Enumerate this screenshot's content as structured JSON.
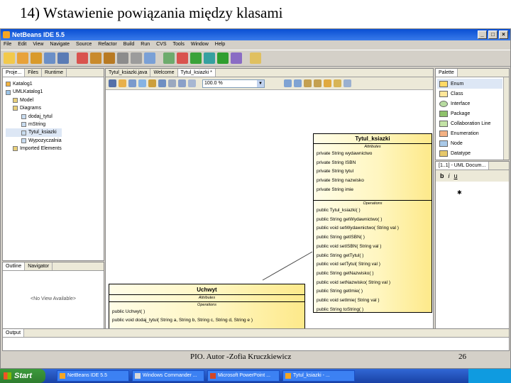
{
  "slide": {
    "title": "14) Wstawienie  powiązania między klasami",
    "footer": "PIO.  Autor -Zofia Kruczkiewicz",
    "page_number": "26"
  },
  "window": {
    "title": "NetBeans IDE 5.5"
  },
  "menu": [
    "File",
    "Edit",
    "View",
    "Navigate",
    "Source",
    "Refactor",
    "Build",
    "Run",
    "CVS",
    "Tools",
    "Window",
    "Help"
  ],
  "projects_panel": {
    "tabs": [
      "Proje...",
      "Files",
      "Runtime"
    ],
    "tree": [
      "Katalog1",
      "UMLKatalog1",
      "Model",
      "Diagrams",
      "dodaj_tytul",
      "mString",
      "Tytul_ksiazki",
      "Wypozyczalnia",
      "Imported Elements"
    ]
  },
  "navigator_panel": {
    "tabs": [
      "Outline",
      "Navigator"
    ],
    "empty_text": "<No View Available>"
  },
  "editor": {
    "tabs": [
      "Tytul_ksiazki.java",
      "Welcome",
      "Tytul_ksiazki *"
    ],
    "zoom": "100.0 %"
  },
  "class_tytul": {
    "name": "Tytul_ksiazki",
    "attributes_title": "Attributes",
    "attributes": [
      "private String wydawnictwo",
      "private String ISBN",
      "private String tytul",
      "private String nazwisko",
      "private String imie"
    ],
    "operations_title": "Operations",
    "operations": [
      "public Tytul_ksiazki(  )",
      "public String getWydawnictwo(  )",
      "public void setWydawnictwo( String val )",
      "public String getISBN(  )",
      "public void setISBN( String val )",
      "public String getTytul(  )",
      "public void setTytul( String val )",
      "public String getNazwisko(  )",
      "public void setNazwisko( String val )",
      "public String getImie(  )",
      "public void setImie( String val )",
      "public String toString(  )"
    ]
  },
  "class_uchwyt": {
    "name": "Uchwyt",
    "attributes_title": "Attributes",
    "operations_title": "Operations",
    "operations": [
      "public Uchwyt(  )",
      "public void dodaj_tytul( String a, String b, String c, String d, String e )"
    ]
  },
  "palette": {
    "tab": "Palette",
    "items": [
      "Class",
      "Interface",
      "Package",
      "Collaboration Line",
      "Enumeration",
      "Node",
      "Datatype"
    ],
    "first_item": "Enum"
  },
  "uml_doc": {
    "tab": "[1..1] - UML Docum...",
    "buttons": [
      "b",
      "i",
      "u"
    ]
  },
  "output": {
    "tab": "Output"
  },
  "taskbar": {
    "start": "Start",
    "tasks": [
      "NetBeans IDE 5.5",
      "Windows Commander ...",
      "Microsoft PowerPoint ...",
      "Tytul_ksiazki - ..."
    ]
  }
}
